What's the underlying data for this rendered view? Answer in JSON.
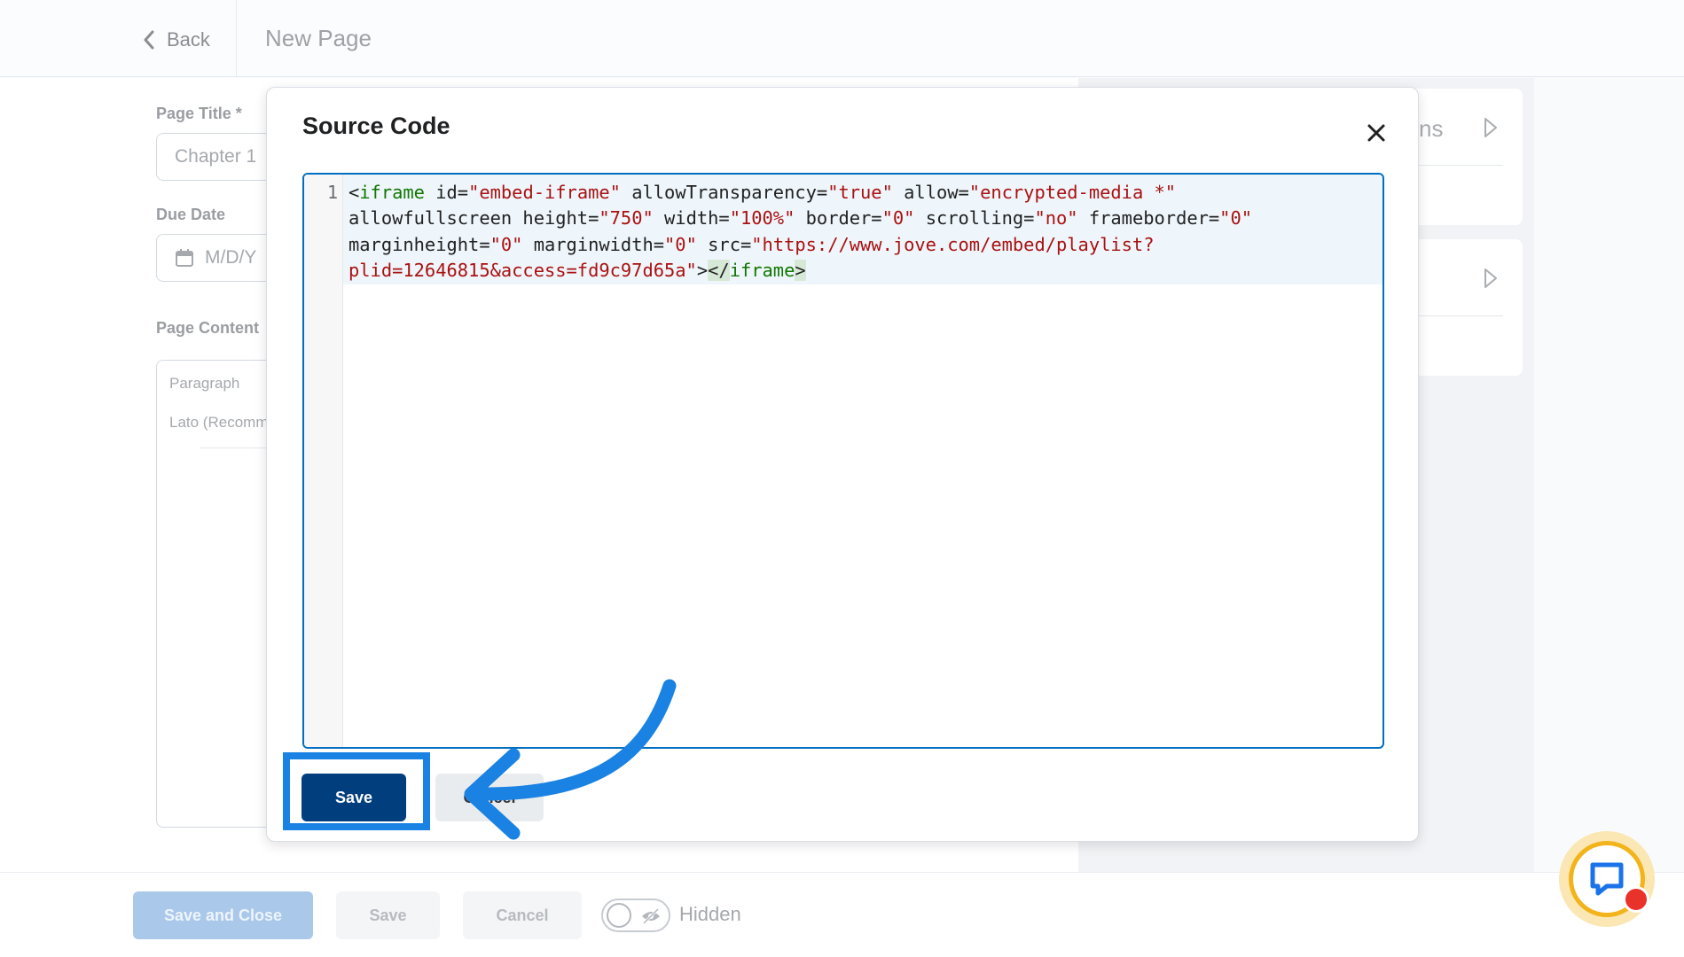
{
  "header": {
    "back_label": "Back",
    "page_heading": "New Page"
  },
  "form": {
    "page_title_label": "Page Title *",
    "page_title_value": "Chapter 1",
    "due_date_label": "Due Date",
    "due_date_placeholder": "M/D/Y",
    "page_content_label": "Page Content",
    "toolbar_format": "Paragraph",
    "toolbar_font": "Lato (Recomm"
  },
  "side_panel": {
    "card1_fragment": "ns"
  },
  "dialog": {
    "title": "Source Code",
    "line_number": "1",
    "code": {
      "l1_lt": "<",
      "l1_tag": "iframe",
      "l1_a1": " id=",
      "l1_v1": "\"embed-iframe\"",
      "l1_a2": " allowTransparency=",
      "l1_v2": "\"true\"",
      "l1_a3": " allow=",
      "l1_v3": "\"encrypted-media *\"",
      "l2_a1": "allowfullscreen height=",
      "l2_v1": "\"750\"",
      "l2_a2": " width=",
      "l2_v2": "\"100%\"",
      "l2_a3": " border=",
      "l2_v3": "\"0\"",
      "l2_a4": " scrolling=",
      "l2_v4": "\"no\"",
      "l2_a5": " frameborder=",
      "l2_v5": "\"0\"",
      "l3_a1": "marginheight=",
      "l3_v1": "\"0\"",
      "l3_a2": " marginwidth=",
      "l3_v2": "\"0\"",
      "l3_a3": " src=",
      "l3_v3": "\"https://www.jove.com/embed/playlist?",
      "l4_v1": "plid=12646815&access=fd9c97d65a\"",
      "l4_gt": ">",
      "l4_close_lt": "</",
      "l4_close_tag": "iframe",
      "l4_close_gt": ">"
    },
    "save_label": "Save",
    "cancel_label": "Cancel"
  },
  "footer": {
    "save_close_label": "Save and Close",
    "save_label": "Save",
    "cancel_label": "Cancel",
    "visibility_label": "Hidden"
  },
  "colors": {
    "primary_button": "#003e7e",
    "editor_border": "#006fbf",
    "annotation_blue": "#1a82e2",
    "tag_green": "#117700",
    "string_red": "#aa1111"
  },
  "icons": {
    "back": "chevron-left-icon",
    "close": "close-icon",
    "calendar": "calendar-icon",
    "visibility": "eye-slash-icon",
    "chat": "chat-bubble-icon",
    "expand": "play-triangle-icon"
  }
}
